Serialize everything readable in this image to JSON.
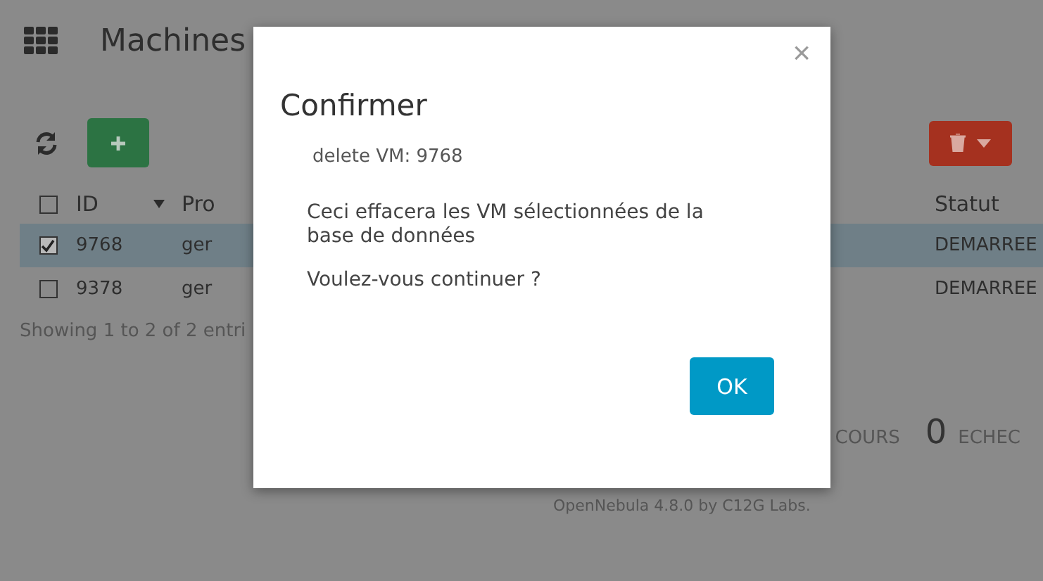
{
  "page": {
    "title": "Machines",
    "table": {
      "all_checked": false,
      "columns": [
        {
          "label": "ID",
          "sorted": true
        },
        {
          "label": "Pro"
        },
        {
          "label": "Statut"
        }
      ],
      "rows": [
        {
          "checked": true,
          "selected": true,
          "id": "9768",
          "column_2": "ger",
          "status": "DEMARREE"
        },
        {
          "checked": false,
          "selected": false,
          "id": "9378",
          "column_2": "ger",
          "status": "DEMARREE"
        }
      ],
      "info": "Showing 1 to 2 of 2 entri"
    },
    "stats": [
      {
        "label": "COURS"
      },
      {
        "count": "0",
        "label": "ECHEC"
      }
    ],
    "footer": "OpenNebula 4.8.0 by C12G Labs."
  },
  "dialog": {
    "title": "Confirmer",
    "subtitle": "delete VM: 9768",
    "message": "Ceci effacera les VM sélectionnées de la base de données",
    "question": "Voulez-vous continuer ?",
    "close": "×",
    "button": "OK"
  }
}
